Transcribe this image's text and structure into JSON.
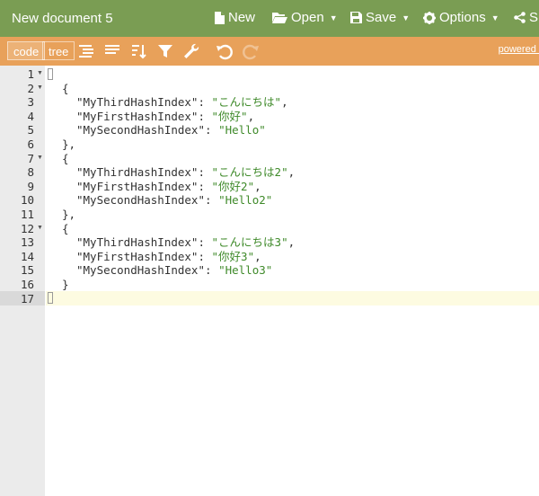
{
  "app": {
    "doc_title": "New document 5",
    "menu": {
      "new_label": "New",
      "open_label": "Open",
      "save_label": "Save",
      "options_label": "Options",
      "share_label": "S"
    }
  },
  "toolbar": {
    "code_label": "code",
    "tree_label": "tree",
    "powered_label": "powered b"
  },
  "editor": {
    "line_numbers": [
      "1",
      "2",
      "3",
      "4",
      "5",
      "6",
      "7",
      "8",
      "9",
      "10",
      "11",
      "12",
      "13",
      "14",
      "15",
      "16",
      "17"
    ],
    "items": [
      {
        "k1": "\"MyThirdHashIndex\"",
        "v1": "\"こんにちは\"",
        "k2": "\"MyFirstHashIndex\"",
        "v2": "\"你好\"",
        "k3": "\"MySecondHashIndex\"",
        "v3": "\"Hello\""
      },
      {
        "k1": "\"MyThirdHashIndex\"",
        "v1": "\"こんにちは2\"",
        "k2": "\"MyFirstHashIndex\"",
        "v2": "\"你好2\"",
        "k3": "\"MySecondHashIndex\"",
        "v3": "\"Hello2\""
      },
      {
        "k1": "\"MyThirdHashIndex\"",
        "v1": "\"こんにちは3\"",
        "k2": "\"MyFirstHashIndex\"",
        "v2": "\"你好3\"",
        "k3": "\"MySecondHashIndex\"",
        "v3": "\"Hello3\""
      }
    ]
  }
}
